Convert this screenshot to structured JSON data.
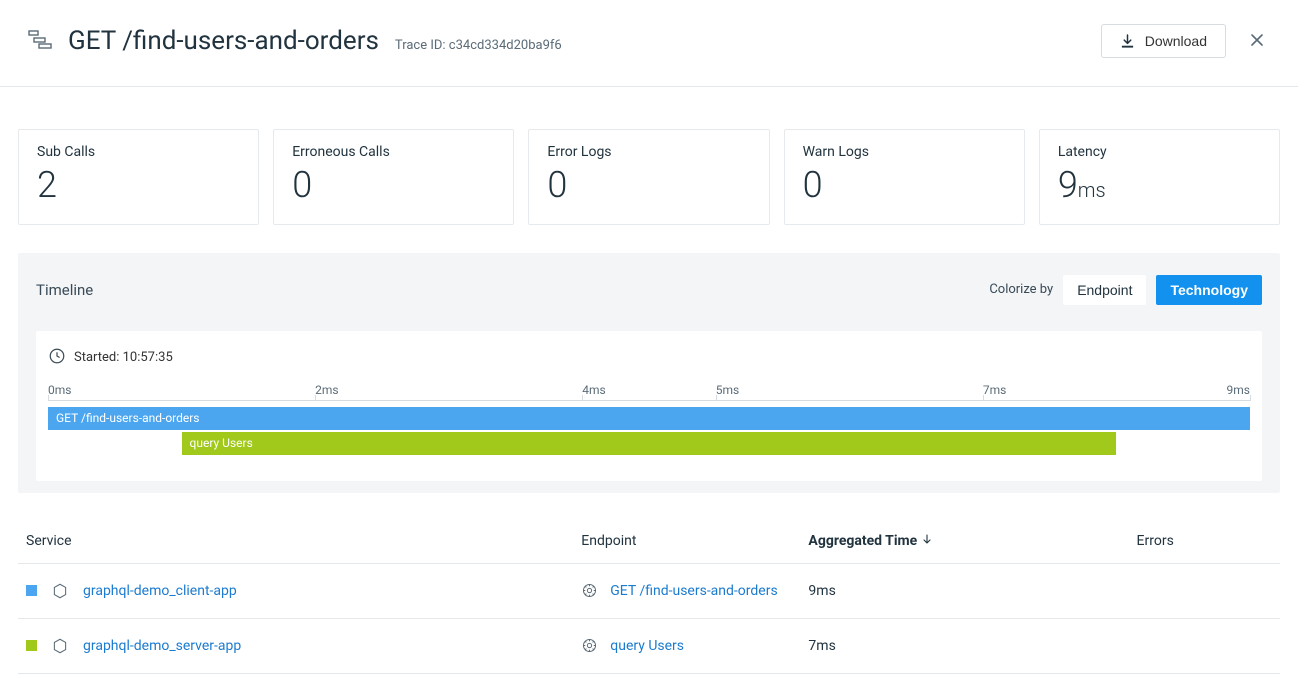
{
  "header": {
    "title": "GET /find-users-and-orders",
    "trace_id_label": "Trace ID: c34cd334d20ba9f6",
    "download_label": "Download"
  },
  "metrics": [
    {
      "label": "Sub Calls",
      "value": "2",
      "unit": ""
    },
    {
      "label": "Erroneous Calls",
      "value": "0",
      "unit": ""
    },
    {
      "label": "Error Logs",
      "value": "0",
      "unit": ""
    },
    {
      "label": "Warn Logs",
      "value": "0",
      "unit": ""
    },
    {
      "label": "Latency",
      "value": "9",
      "unit": "ms"
    }
  ],
  "timeline": {
    "title": "Timeline",
    "colorize_label": "Colorize by",
    "options": {
      "endpoint": "Endpoint",
      "technology": "Technology"
    },
    "active": "technology",
    "started": "Started: 10:57:35",
    "axis": {
      "min": 0,
      "max": 9,
      "unit": "ms",
      "ticks": [
        0,
        2,
        4,
        5,
        7,
        9
      ]
    },
    "bars": [
      {
        "label": "GET /find-users-and-orders",
        "start": 0,
        "end": 9,
        "color": "#4ba5ef",
        "row": 0
      },
      {
        "label": "query Users",
        "start": 1,
        "end": 8,
        "color": "#a1c91b",
        "row": 1
      }
    ]
  },
  "table": {
    "columns": {
      "service": "Service",
      "endpoint": "Endpoint",
      "aggregated_time": "Aggregated Time",
      "errors": "Errors"
    },
    "sort_column": "aggregated_time",
    "sort_dir": "desc",
    "rows": [
      {
        "color": "#4ba5ef",
        "service": "graphql-demo_client-app",
        "endpoint": "GET /find-users-and-orders",
        "aggregated_time": "9ms",
        "errors": ""
      },
      {
        "color": "#a1c91b",
        "service": "graphql-demo_server-app",
        "endpoint": "query Users",
        "aggregated_time": "7ms",
        "errors": ""
      }
    ]
  }
}
